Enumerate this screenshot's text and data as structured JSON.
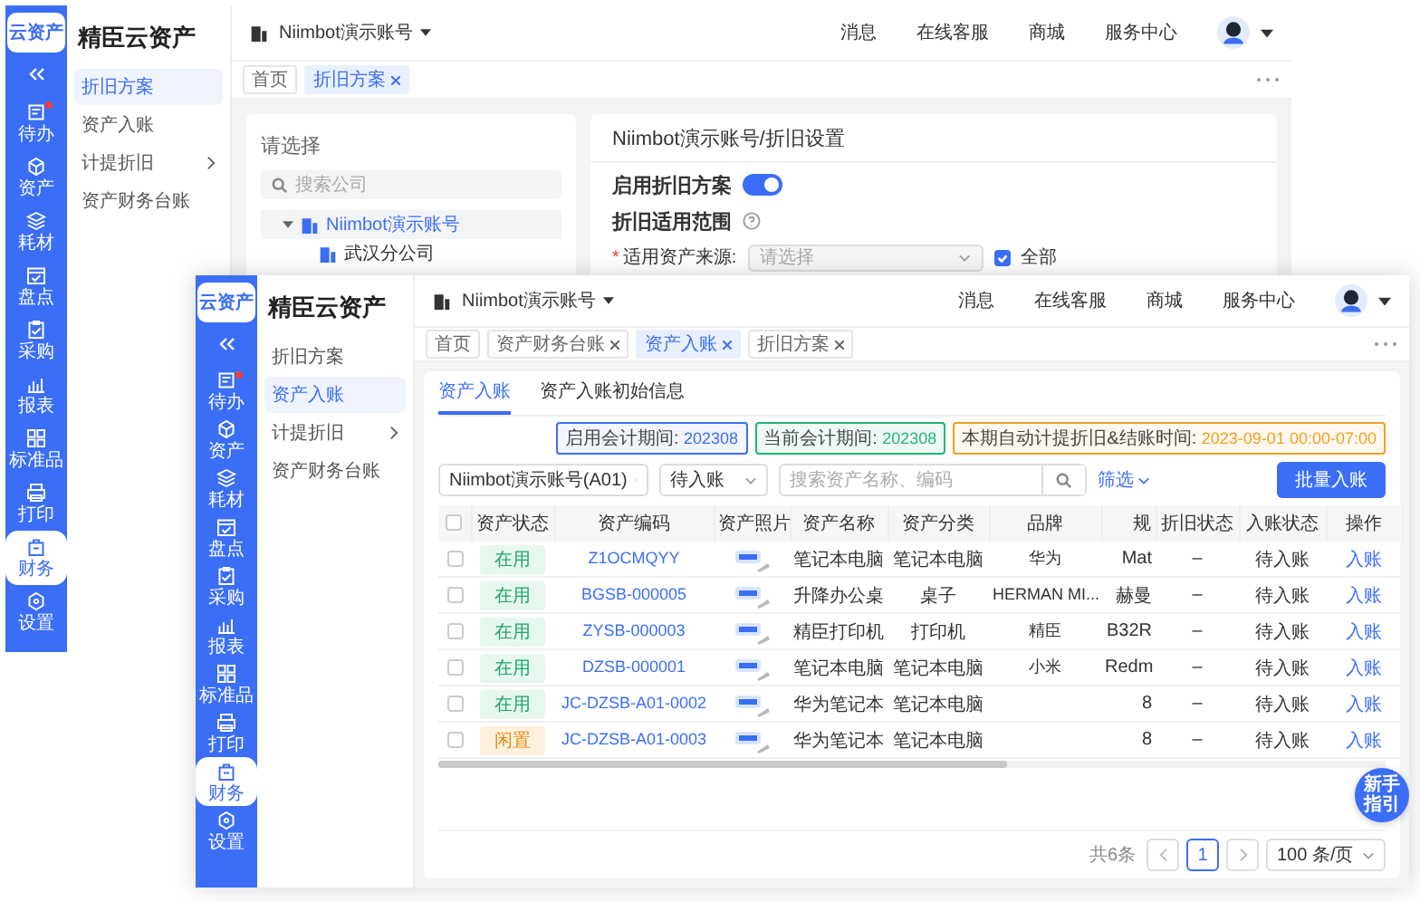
{
  "back_window": {
    "logo": "云资产",
    "app_name": "精臣云资产",
    "rail": [
      {
        "label": "待办",
        "selected": false,
        "dot": true
      },
      {
        "label": "资产",
        "selected": false,
        "dot": false
      },
      {
        "label": "耗材",
        "selected": false,
        "dot": false
      },
      {
        "label": "盘点",
        "selected": false,
        "dot": false
      },
      {
        "label": "采购",
        "selected": false,
        "dot": false
      },
      {
        "label": "报表",
        "selected": false,
        "dot": false
      },
      {
        "label": "标准品",
        "selected": false,
        "dot": false
      },
      {
        "label": "打印",
        "selected": false,
        "dot": false
      },
      {
        "label": "财务",
        "selected": true,
        "dot": false
      },
      {
        "label": "设置",
        "selected": false,
        "dot": false
      }
    ],
    "menu": [
      {
        "label": "折旧方案",
        "selected": true,
        "expandable": false
      },
      {
        "label": "资产入账",
        "selected": false,
        "expandable": false
      },
      {
        "label": "计提折旧",
        "selected": false,
        "expandable": true
      },
      {
        "label": "资产财务台账",
        "selected": false,
        "expandable": false
      }
    ],
    "account": "Niimbot演示账号",
    "header_links": [
      "消息",
      "在线客服",
      "商城",
      "服务中心"
    ],
    "tabs": [
      {
        "label": "首页",
        "selected": false,
        "closable": false
      },
      {
        "label": "折旧方案",
        "selected": true,
        "closable": true
      }
    ],
    "tree_panel": {
      "title": "请选择",
      "search_placeholder": "搜索公司",
      "tree": [
        {
          "label": "Niimbot演示账号",
          "selected": true,
          "expanded": true,
          "children": [
            {
              "label": "武汉分公司",
              "selected": false
            }
          ]
        }
      ]
    },
    "settings": {
      "breadcrumb": "Niimbot演示账号/折旧设置",
      "enable_label": "启用折旧方案",
      "enabled": true,
      "scope_label": "折旧适用范围",
      "required_mark": "*",
      "source_label": "适用资产来源:",
      "source_placeholder": "请选择",
      "all_label": "全部",
      "all_checked": true
    }
  },
  "front_window": {
    "logo": "云资产",
    "app_name": "精臣云资产",
    "rail": [
      {
        "label": "待办",
        "selected": false,
        "dot": true
      },
      {
        "label": "资产",
        "selected": false,
        "dot": false
      },
      {
        "label": "耗材",
        "selected": false,
        "dot": false
      },
      {
        "label": "盘点",
        "selected": false,
        "dot": false
      },
      {
        "label": "采购",
        "selected": false,
        "dot": false
      },
      {
        "label": "报表",
        "selected": false,
        "dot": false
      },
      {
        "label": "标准品",
        "selected": false,
        "dot": false
      },
      {
        "label": "打印",
        "selected": false,
        "dot": false
      },
      {
        "label": "财务",
        "selected": true,
        "dot": false
      },
      {
        "label": "设置",
        "selected": false,
        "dot": false
      }
    ],
    "menu": [
      {
        "label": "折旧方案",
        "selected": false,
        "expandable": false
      },
      {
        "label": "资产入账",
        "selected": true,
        "expandable": false
      },
      {
        "label": "计提折旧",
        "selected": false,
        "expandable": true
      },
      {
        "label": "资产财务台账",
        "selected": false,
        "expandable": false
      }
    ],
    "account": "Niimbot演示账号",
    "header_links": [
      "消息",
      "在线客服",
      "商城",
      "服务中心"
    ],
    "tabs": [
      {
        "label": "首页",
        "selected": false,
        "closable": false
      },
      {
        "label": "资产财务台账",
        "selected": false,
        "closable": true
      },
      {
        "label": "资产入账",
        "selected": true,
        "closable": true
      },
      {
        "label": "折旧方案",
        "selected": false,
        "closable": true
      }
    ],
    "page_tabs": [
      {
        "label": "资产入账",
        "selected": true
      },
      {
        "label": "资产入账初始信息",
        "selected": false
      }
    ],
    "info_tags": [
      {
        "label": "启用会计期间:",
        "value": "202308",
        "color": "#3b6ef6"
      },
      {
        "label": "当前会计期间:",
        "value": "202308",
        "color": "#22b573"
      },
      {
        "label": "本期自动计提折旧&结账时间:",
        "value": "2023-09-01 00:00-07:00",
        "color": "#f0a020"
      }
    ],
    "filters": {
      "account": "Niimbot演示账号(A01)",
      "status": "待入账",
      "search_placeholder": "搜索资产名称、编码",
      "filter_label": "筛选",
      "batch_button": "批量入账"
    },
    "table": {
      "all_checked": false,
      "columns": [
        "资产状态",
        "资产编码",
        "资产照片",
        "资产名称",
        "资产分类",
        "品牌",
        "规",
        "折旧状态",
        "入账状态",
        "操作"
      ],
      "rows": [
        {
          "checked": false,
          "status": {
            "label": "在用",
            "kind": "in_use"
          },
          "code": "Z1OCMQYY",
          "name": "笔记本电脑",
          "category": "笔记本电脑",
          "brand": "华为",
          "spec": "Mat",
          "depreciation": "–",
          "entry_status": "待入账",
          "action": "入账"
        },
        {
          "checked": false,
          "status": {
            "label": "在用",
            "kind": "in_use"
          },
          "code": "BGSB-000005",
          "name": "升降办公桌",
          "category": "桌子",
          "brand": "HERMAN MI...",
          "spec": "赫曼",
          "depreciation": "–",
          "entry_status": "待入账",
          "action": "入账"
        },
        {
          "checked": false,
          "status": {
            "label": "在用",
            "kind": "in_use"
          },
          "code": "ZYSB-000003",
          "name": "精臣打印机",
          "category": "打印机",
          "brand": "精臣",
          "spec": "B32R",
          "depreciation": "–",
          "entry_status": "待入账",
          "action": "入账"
        },
        {
          "checked": false,
          "status": {
            "label": "在用",
            "kind": "in_use"
          },
          "code": "DZSB-000001",
          "name": "笔记本电脑",
          "category": "笔记本电脑",
          "brand": "小米",
          "spec": "Redm",
          "depreciation": "–",
          "entry_status": "待入账",
          "action": "入账"
        },
        {
          "checked": false,
          "status": {
            "label": "在用",
            "kind": "in_use"
          },
          "code": "JC-DZSB-A01-0002",
          "name": "华为笔记本",
          "category": "笔记本电脑",
          "brand": "",
          "spec": "8",
          "depreciation": "–",
          "entry_status": "待入账",
          "action": "入账"
        },
        {
          "checked": false,
          "status": {
            "label": "闲置",
            "kind": "idle"
          },
          "code": "JC-DZSB-A01-0003",
          "name": "华为笔记本",
          "category": "笔记本电脑",
          "brand": "",
          "spec": "8",
          "depreciation": "–",
          "entry_status": "待入账",
          "action": "入账"
        }
      ]
    },
    "pagination": {
      "total": "共6条",
      "pages": [
        {
          "label": "1",
          "selected": true
        }
      ],
      "page_size": "100 条/页"
    },
    "guide_button": "新手指引"
  }
}
